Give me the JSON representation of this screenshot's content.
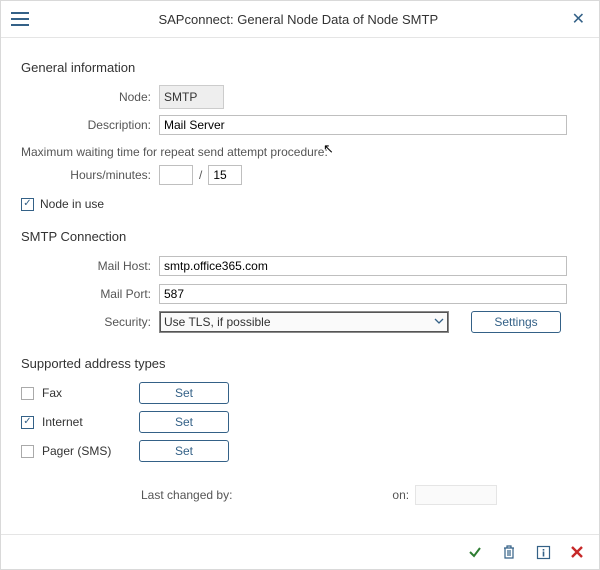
{
  "header": {
    "title": "SAPconnect: General Node Data of Node SMTP"
  },
  "general": {
    "section": "General information",
    "node_label": "Node:",
    "node_value": "SMTP",
    "description_label": "Description:",
    "description_value": "Mail Server",
    "wait_text": "Maximum waiting time for repeat send attempt procedure:",
    "hours_minutes_label": "Hours/minutes:",
    "hours_value": "",
    "minutes_value": "15",
    "node_in_use_label": "Node in use"
  },
  "smtp": {
    "section": "SMTP Connection",
    "mail_host_label": "Mail Host:",
    "mail_host_value": "smtp.office365.com",
    "mail_port_label": "Mail Port:",
    "mail_port_value": "587",
    "security_label": "Security:",
    "security_value": "Use TLS, if possible",
    "settings_label": "Settings"
  },
  "addr": {
    "section": "Supported address types",
    "fax_label": "Fax",
    "internet_label": "Internet",
    "pager_label": "Pager (SMS)",
    "set_label": "Set"
  },
  "meta": {
    "last_changed_by_label": "Last changed by:",
    "on_label": "on:"
  }
}
